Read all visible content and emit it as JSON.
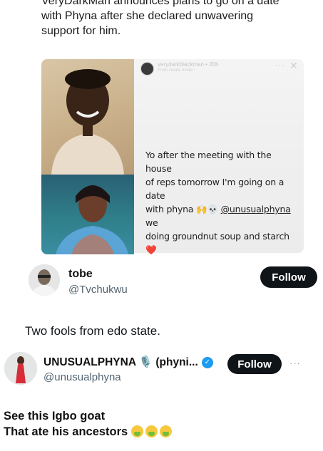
{
  "headline": {
    "text": "VeryDarkMan announces plans to go on a date with Phyna after she declared unwavering support for him."
  },
  "story": {
    "username": "verydarkblackman",
    "time": "20h",
    "subline": "From create mode ›",
    "line1": "Yo after the meeting with the house",
    "line2": "of reps tomorrow I'm going on a date",
    "line3_prefix": "with phyna 🙌💀 ",
    "mention": "@unusualphyna",
    "line3_suffix": " we",
    "line4": "doing groundnut soup and starch ❤️"
  },
  "tweet1": {
    "name": "tobe",
    "handle": "@Tvchukwu",
    "follow_label": "Follow",
    "text": "Two fools from edo state."
  },
  "tweet2": {
    "name": "UNUSUALPHYNA 🎙️ (phyni...",
    "handle": "@unusualphyna",
    "follow_label": "Follow",
    "text_line1": "See this Igbo goat",
    "text_line2": "That ate his ancestors"
  },
  "icons": {
    "verified": "verified-badge-icon",
    "more": "more-options-icon",
    "close": "close-icon",
    "nauseated": "nauseated-face-icon"
  },
  "colors": {
    "follow_bg": "#0f1419",
    "handle": "#536471",
    "verified": "#1d9bf0"
  }
}
